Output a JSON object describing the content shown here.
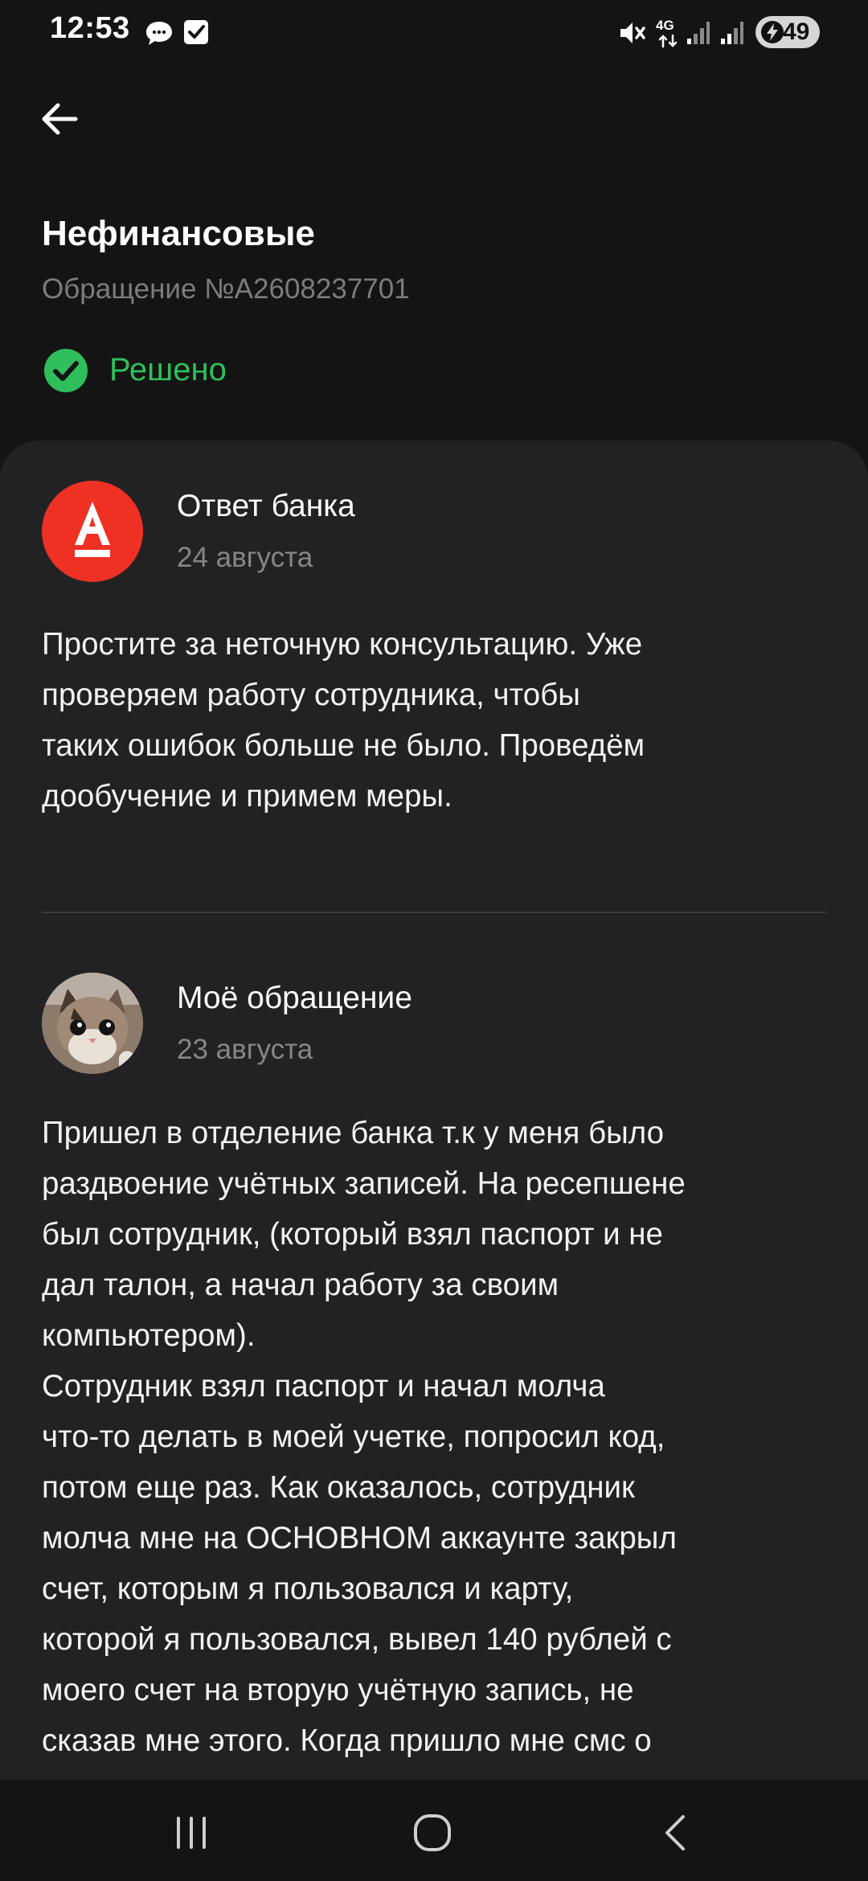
{
  "status_bar": {
    "time": "12:53",
    "battery": "49",
    "network": "4G",
    "icons": [
      "chat-bubble-icon",
      "checkbox-icon",
      "mute-icon",
      "network-4g-icon",
      "signal-icon",
      "signal-icon",
      "charging-bolt-icon"
    ]
  },
  "header": {
    "back_icon": "arrow-left-icon",
    "category": "Нефинансовые",
    "ticket_number": "Обращение №A2608237701",
    "status": "Решено",
    "status_color": "#2fbf5a"
  },
  "messages": [
    {
      "author": "Ответ банка",
      "date": "24 августа",
      "avatar_color": "#ef3124",
      "avatar_letter": "А",
      "body_lines": [
        "Простите за неточную консультацию. Уже",
        "проверяем работу сотрудника, чтобы",
        "таких ошибок больше не было. Проведём",
        "дообучение и примем меры."
      ]
    },
    {
      "author": "Моё обращение",
      "date": "23 августа",
      "body_lines": [
        "Пришел в отделение банка т.к у меня было",
        "раздвоение учётных записей. На ресепшене",
        "был сотрудник, (который взял паспорт и не",
        "дал талон, а начал работу за своим",
        "компьютером).",
        "Сотрудник взял паспорт и начал молча",
        "что-то делать в моей учетке, попросил код,",
        "потом еще раз. Как оказалось, сотрудник",
        "молча мне на ОСНОВНОМ аккаунте закрыл",
        "счет, которым я пользовался и карту,",
        "которой я пользовался, вывел 140 рублей с",
        "моего счет на вторую учётную запись, не",
        "сказав мне этого. Когда пришло мне смс о"
      ]
    }
  ],
  "nav_bar": {
    "buttons": [
      "recent-apps-icon",
      "home-icon",
      "back-chevron-icon"
    ]
  },
  "colors": {
    "background": "#141414",
    "card": "#222224",
    "brand_red": "#ef3124",
    "success_green": "#2fbf5a"
  }
}
